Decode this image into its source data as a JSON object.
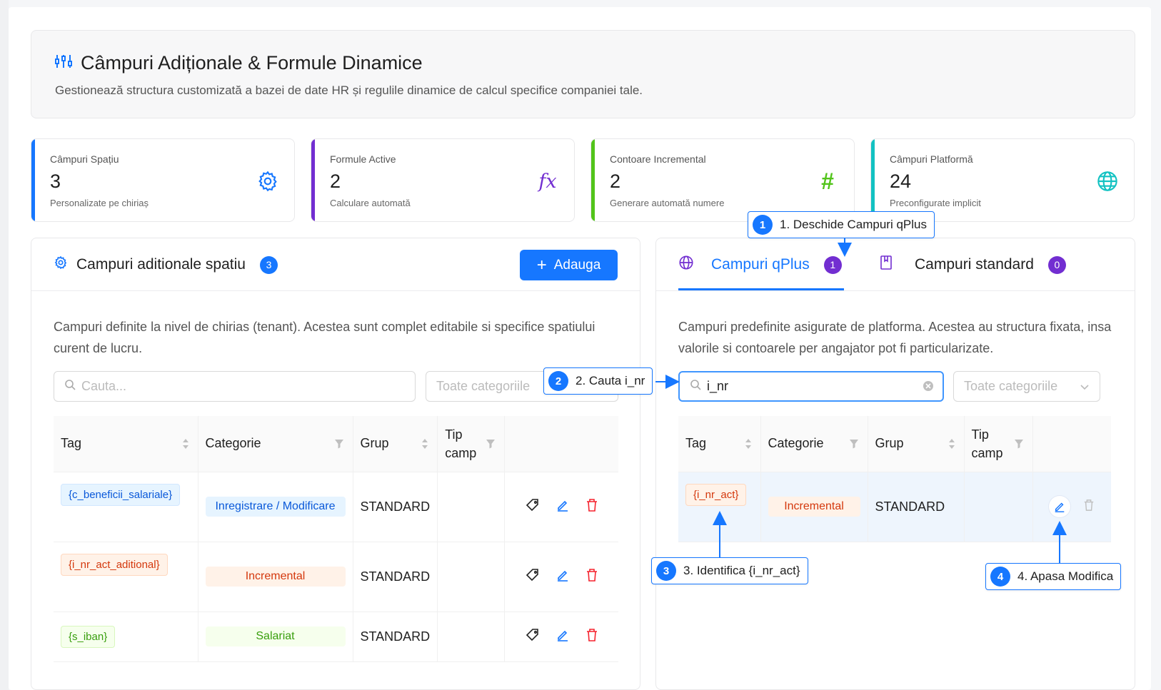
{
  "header": {
    "title": "Câmpuri Adiționale & Formule Dinamice",
    "subtitle": "Gestionează structura customizată a bazei de date HR și regulile dinamice de calcul specifice companiei tale."
  },
  "stats": [
    {
      "label": "Câmpuri Spațiu",
      "value": "3",
      "sub": "Personalizate pe chiriaș",
      "color": "#1677ff",
      "icon": "gear-icon"
    },
    {
      "label": "Formule Active",
      "value": "2",
      "sub": "Calculare automată",
      "color": "#722ed1",
      "icon": "fx-icon",
      "icon_text": "fx"
    },
    {
      "label": "Contoare Incremental",
      "value": "2",
      "sub": "Generare automată numere",
      "color": "#52c41a",
      "icon": "hash-icon",
      "icon_text": "#"
    },
    {
      "label": "Câmpuri Platformă",
      "value": "24",
      "sub": "Preconfigurate implicit",
      "color": "#13c2c2",
      "icon": "globe-icon"
    }
  ],
  "left_panel": {
    "title": "Campuri aditionale spatiu",
    "count": "3",
    "add_label": "Adauga",
    "description": "Campuri definite la nivel de chirias (tenant). Acestea sunt complet editabile si specifice spatiului curent de lucru.",
    "search_placeholder": "Cauta...",
    "category_placeholder": "Toate categoriile",
    "columns": [
      "Tag",
      "Categorie",
      "Grup",
      "Tip camp"
    ],
    "rows": [
      {
        "tag": "{c_beneficii_salariale}",
        "category": "Inregistrare / Modificare",
        "group": "STANDARD",
        "tip": ""
      },
      {
        "tag": "{i_nr_act_aditional}",
        "category": "Incremental",
        "group": "STANDARD",
        "tip": ""
      },
      {
        "tag": "{s_iban}",
        "category": "Salariat",
        "group": "STANDARD",
        "tip": ""
      }
    ]
  },
  "right_panel": {
    "tabs": [
      {
        "label": "Campuri qPlus",
        "count": "1",
        "active": true
      },
      {
        "label": "Campuri standard",
        "count": "0",
        "active": false
      }
    ],
    "description": "Campuri predefinite asigurate de platforma. Acestea au structura fixata, insa valorile si contoarele per angajator pot fi particularizate.",
    "search_value": "i_nr",
    "category_placeholder": "Toate categoriile",
    "columns": [
      "Tag",
      "Categorie",
      "Grup",
      "Tip camp"
    ],
    "rows": [
      {
        "tag": "{i_nr_act}",
        "category": "Incremental",
        "group": "STANDARD",
        "tip": ""
      }
    ]
  },
  "callouts": [
    {
      "num": "1",
      "text": "1. Deschide Campuri qPlus"
    },
    {
      "num": "2",
      "text": "2. Cauta i_nr"
    },
    {
      "num": "3",
      "text": "3. Identifica {i_nr_act}"
    },
    {
      "num": "4",
      "text": "4. Apasa Modifica"
    }
  ],
  "colors": {
    "primary": "#1677ff",
    "purple": "#722ed1",
    "green": "#52c41a",
    "cyan": "#13c2c2",
    "danger": "#f5222d"
  }
}
